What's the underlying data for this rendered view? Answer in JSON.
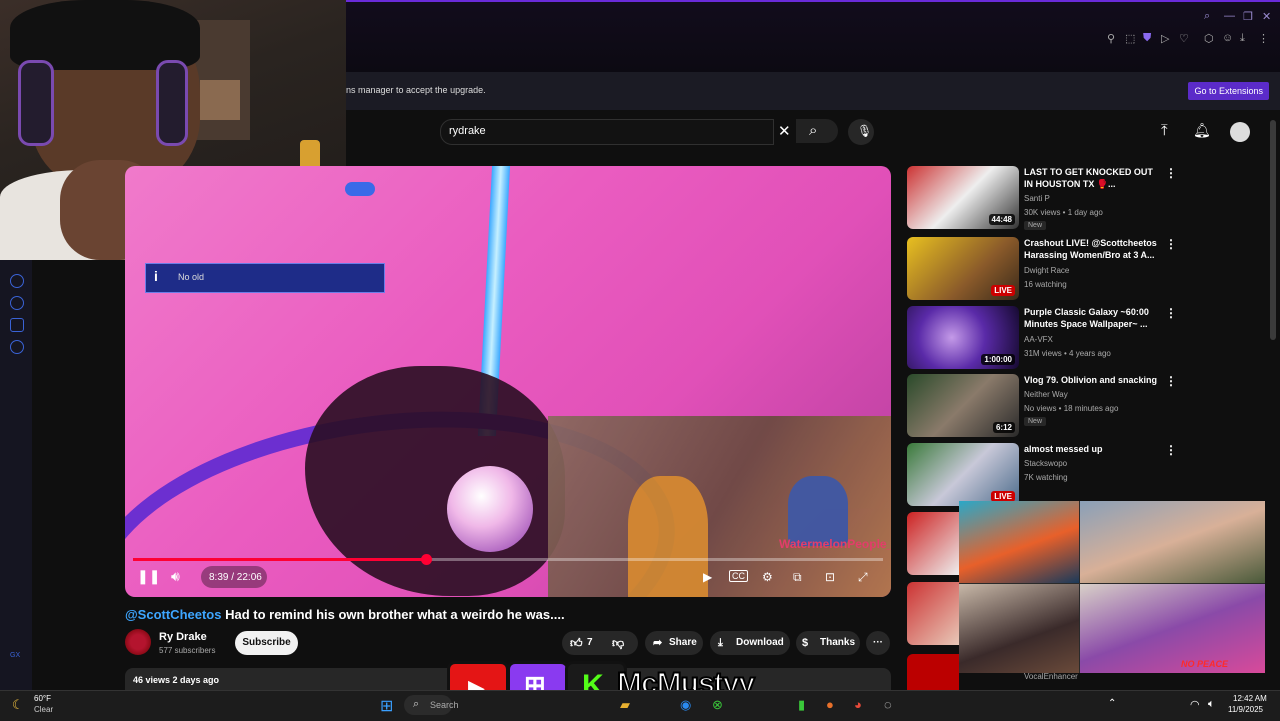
{
  "notice": {
    "text": "ns manager to accept the upgrade.",
    "button": "Go to Extensions"
  },
  "search": {
    "value": "rydrake"
  },
  "video": {
    "banner": "No         old",
    "watermark": "WatermelonPeople_TV",
    "time": "8:39 / 22:06",
    "progress": 0.39
  },
  "title": {
    "tag": "@ScottCheetos",
    "text": " Had to remind his own brother what a weirdo he was...."
  },
  "channel": {
    "name": "Ry Drake",
    "subs": "577 subscribers",
    "subscribe": "Subscribe"
  },
  "actions": {
    "likes": "7",
    "share": "Share",
    "download": "Download",
    "thanks": "Thanks"
  },
  "description": {
    "text": "46 views  2 days ago"
  },
  "recs": [
    {
      "title": "LAST TO GET KNOCKED OUT IN HOUSTON TX 🥊...",
      "channel": "Santi P",
      "meta": "30K views • 1 day ago",
      "badge": "New",
      "duration": "44:48"
    },
    {
      "title": "Crashout LIVE! @Scottcheetos Harassing Women/Bro at 3 A...",
      "channel": "Dwight Race",
      "meta": "16 watching",
      "live": "LIVE"
    },
    {
      "title": "Purple Classic Galaxy ~60:00 Minutes Space Wallpaper~ ...",
      "channel": "AA-VFX",
      "meta": "31M views • 4 years ago",
      "duration": "1:00:00"
    },
    {
      "title": "Vlog 79. Oblivion and snacking",
      "channel": "Neither Way",
      "meta": "No views • 18 minutes ago",
      "badge": "New",
      "duration": "6:12"
    },
    {
      "title": "almost messed up",
      "channel": "Stackswopo",
      "meta": "7K watching",
      "live": "LIVE"
    }
  ],
  "collage": {
    "caption": "NO PEACE",
    "bottom_channel": "VocalEnhancer"
  },
  "overlay": {
    "brand": "McMustyy"
  },
  "taskbar": {
    "temp": "60°F",
    "condition": "Clear",
    "search": "Search",
    "time": "12:42 AM",
    "date": "11/9/2025"
  },
  "sidebar_label": "GX",
  "colors": {
    "accent": "#6a2bd9",
    "yt_red": "#ff0033",
    "link": "#3ea6ff"
  }
}
